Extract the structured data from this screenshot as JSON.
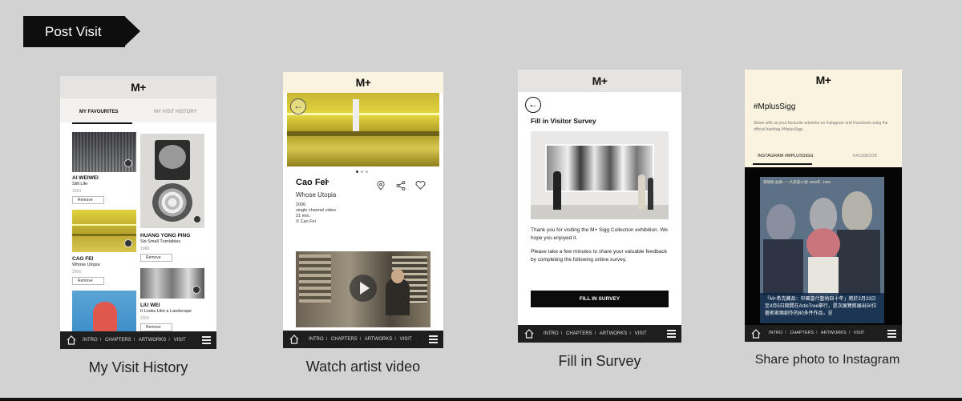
{
  "heading": "Post Visit",
  "bar": {
    "home_icon": "home-icon",
    "links": [
      "INTRO",
      "CHAPTERS",
      "ARTWORKS",
      "VISIT"
    ],
    "menu_icon": "hamburger-icon"
  },
  "screen1": {
    "logo": "M+",
    "tabs": [
      "MY FAVOURITES",
      "MY VISIT HISTORY"
    ],
    "remove": "Remove",
    "items": [
      {
        "artist": "AI WEIWEI",
        "work": "Still Life",
        "year": "1993"
      },
      {
        "artist": "HUANG YONG PING",
        "work": "Six Small Turntables",
        "year": "1988"
      },
      {
        "artist": "CAO FEI",
        "work": "Whose Utopia",
        "year": "2006"
      },
      {
        "artist": "LIU WEI",
        "work": "It Looks Like a Landscape",
        "year": "2004"
      }
    ],
    "caption": "My Visit History"
  },
  "screen2": {
    "logo": "M+",
    "artist": "Cao Fei",
    "chevron": ">",
    "work": "Whose Utopia",
    "details": [
      "2006",
      "single channel video",
      "21 min.",
      "© Cao Fei"
    ],
    "caption": "Watch artist video"
  },
  "screen3": {
    "logo": "M+",
    "title": "Fill in Visitor Survey",
    "para1": "Thank you for visiting the M+ Sigg Collection exhibition. We hope you enjoyed it.",
    "para2": "Please take a few minutes to share your valuable feedback by completing the following online survey.",
    "button": "FILL IN SURVEY",
    "caption": "Fill in Survey"
  },
  "screen4": {
    "logo": "M+",
    "hashtag": "#MplusSigg",
    "intro": "Share with us your favourite artworks on Instagram and Facebook using the official hashtag #MplusSigg.",
    "tabs": [
      "INSTAGRAM #MPLUSSIGG",
      "FACEBOOK"
    ],
    "photo_top": "張曉剛  血緣——大家庭17號 1998年, 1998",
    "photo_caption": "「M+希克藏品：中國當代藝術四十年」將於2月23日至4月5日期間在ArtisTree舉行，是次展覽將展出50位藝術家兩創作的80多件作品，呈",
    "caption": "Share photo to Instagram"
  },
  "colors": {
    "dark": "#1e1e1e",
    "cream": "#faf3e0",
    "yellow": "#d9cf57"
  }
}
